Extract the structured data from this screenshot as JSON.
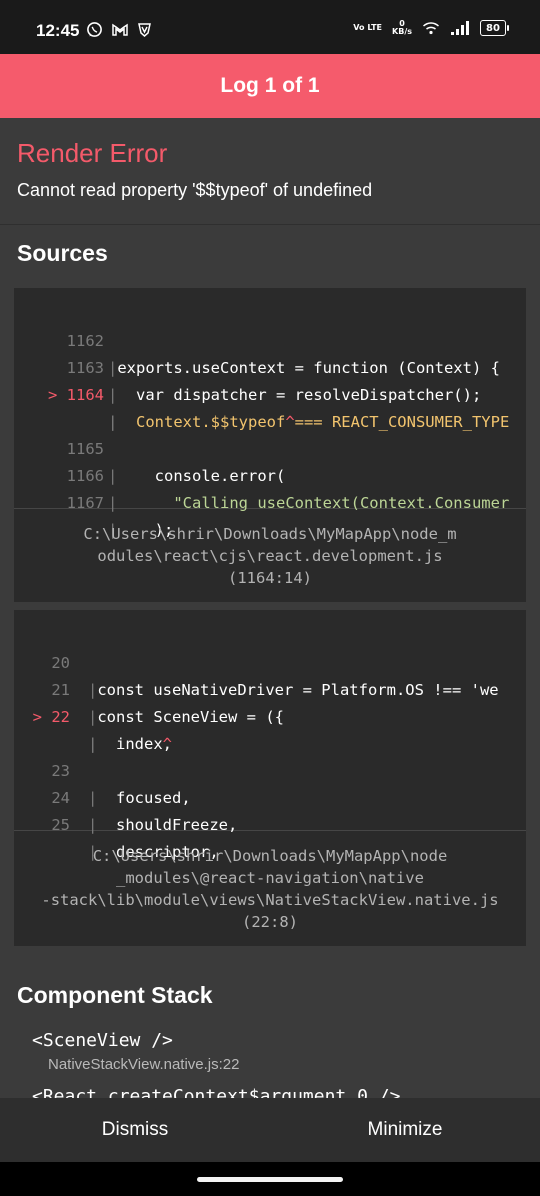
{
  "status": {
    "time": "12:45",
    "network": "Vo LTE",
    "speed_value": "0",
    "speed_unit": "KB/s",
    "battery": "80"
  },
  "header": {
    "title": "Log 1 of 1"
  },
  "error": {
    "title": "Render Error",
    "message": "Cannot read property '$$typeof' of undefined"
  },
  "sections": {
    "sources_title": "Sources",
    "component_stack_title": "Component Stack"
  },
  "code_frames": [
    {
      "lines": [
        {
          "number": "1162",
          "marker": "",
          "text": "exports.useContext = function (Context) {"
        },
        {
          "number": "1163",
          "marker": "",
          "text": "  var dispatcher = resolveDispatcher();"
        },
        {
          "number": "1164",
          "marker": ">",
          "text": "  Context.$$typeof === REACT_CONSUMER_TYPE"
        },
        {
          "number": "",
          "marker": "",
          "text": "                  ^"
        },
        {
          "number": "1165",
          "marker": "",
          "text": "    console.error("
        },
        {
          "number": "1166",
          "marker": "",
          "text": "      \"Calling useContext(Context.Consumer"
        },
        {
          "number": "1167",
          "marker": "",
          "text": "    );"
        }
      ],
      "path": "C:\\Users\\shrir\\Downloads\\MyMapApp\\node_m\nodules\\react\\cjs\\react.development.js\n(1164:14)"
    },
    {
      "lines": [
        {
          "number": "20",
          "marker": "",
          "text": "const useNativeDriver = Platform.OS !== 'we"
        },
        {
          "number": "21",
          "marker": "",
          "text": "const SceneView = ({"
        },
        {
          "number": "22",
          "marker": ">",
          "text": "  index,"
        },
        {
          "number": "",
          "marker": "",
          "text": "       ^"
        },
        {
          "number": "23",
          "marker": "",
          "text": "  focused,"
        },
        {
          "number": "24",
          "marker": "",
          "text": "  shouldFreeze,"
        },
        {
          "number": "25",
          "marker": "",
          "text": "  descriptor,"
        }
      ],
      "path": "C:\\Users\\shrir\\Downloads\\MyMapApp\\node\n_modules\\@react-navigation\\native\n-stack\\lib\\module\\views\\NativeStackView.native.js\n(22:8)"
    }
  ],
  "component_stack": [
    {
      "name": "<SceneView />",
      "file": "NativeStackView.native.js:22"
    },
    {
      "name": "<React.createContext$argument_0 />",
      "file": ""
    }
  ],
  "footer": {
    "dismiss": "Dismiss",
    "minimize": "Minimize"
  },
  "colors": {
    "accent": "#f55b6c",
    "background": "#3b3b3b",
    "code_background": "#2a2a2a"
  }
}
